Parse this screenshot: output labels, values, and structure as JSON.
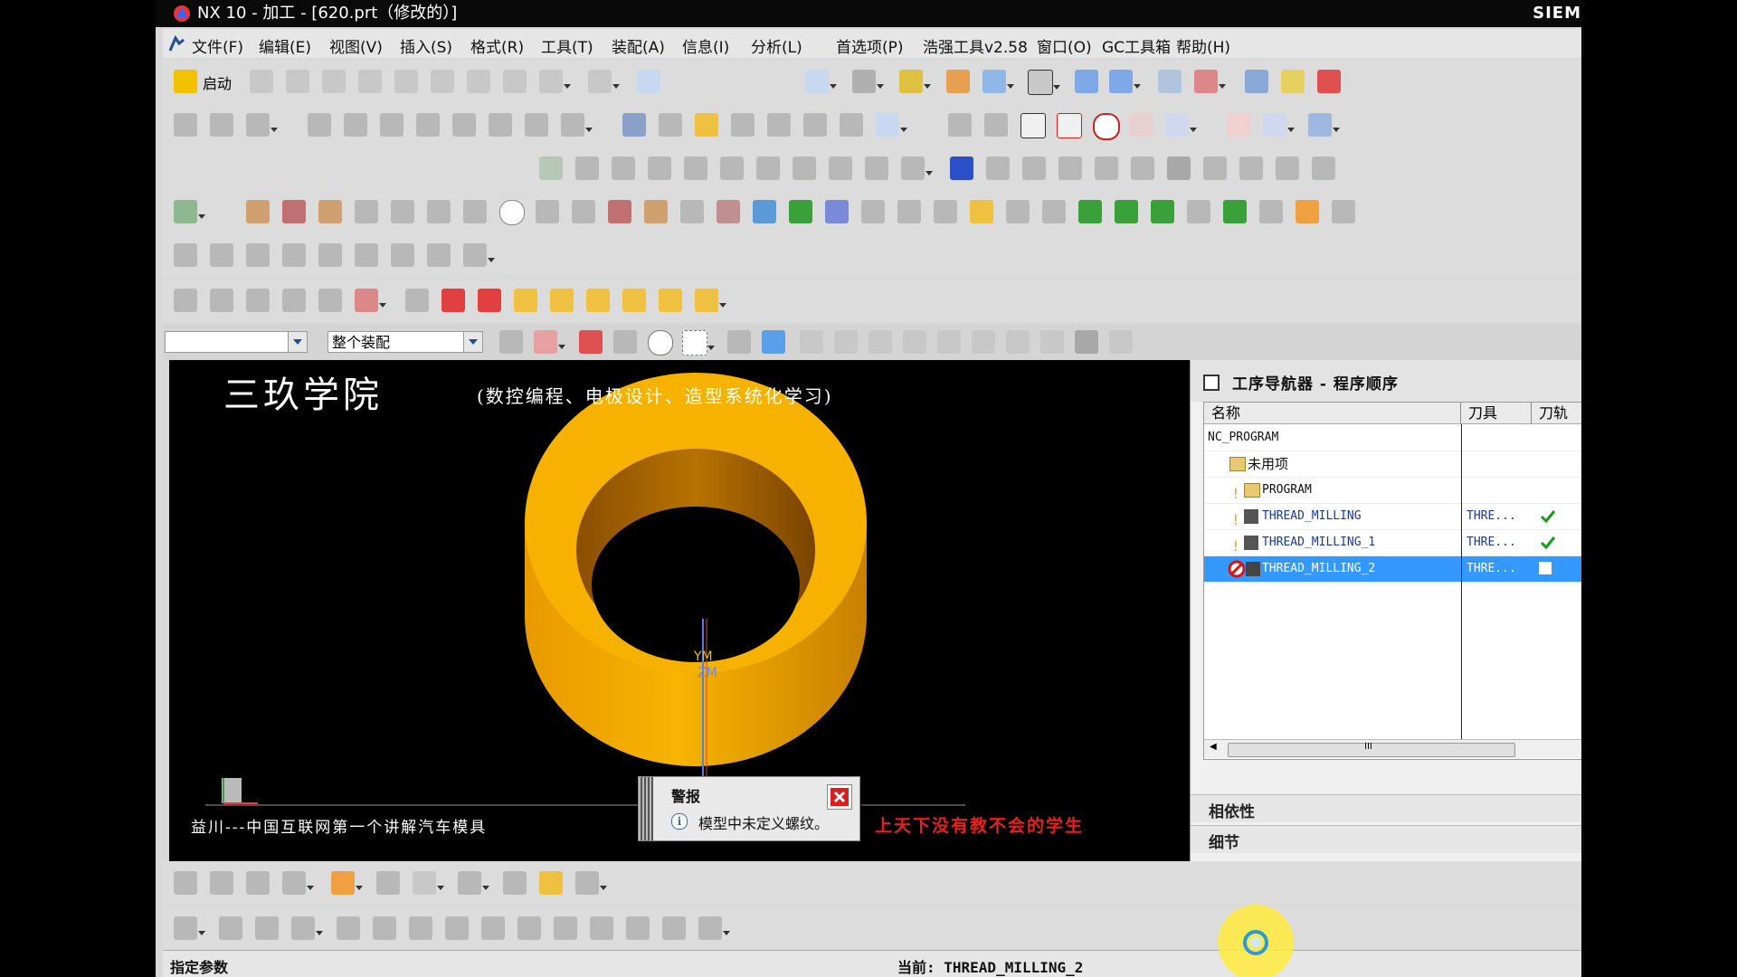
{
  "window": {
    "title": "NX 10 - 加工 - [620.prt（修改的）]",
    "brand": "SIEM"
  },
  "menu": {
    "items": [
      "文件(F)",
      "编辑(E)",
      "视图(V)",
      "插入(S)",
      "格式(R)",
      "工具(T)",
      "装配(A)",
      "信息(I)",
      "分析(L)",
      "首选项(P)",
      "浩强工具v2.58",
      "窗口(O)",
      "GC工具箱",
      "帮助(H)"
    ]
  },
  "toolbar": {
    "start_label": "启动"
  },
  "selection_bar": {
    "filter_value": "",
    "scope_value": "整个装配"
  },
  "viewport": {
    "watermark_title": "三玖学院",
    "watermark_subtitle": "(数控编程、电极设计、造型系统化学习)",
    "watermark_bottom_left": "益川---中国互联网第一个讲解汽车模具",
    "watermark_bottom_right": "上天下没有教不会的学生",
    "axis_labels": {
      "ym": "YM",
      "zm": "ZM"
    },
    "part_color": "#f0a800"
  },
  "alert": {
    "title": "警报",
    "message": "模型中未定义螺纹。"
  },
  "navigator": {
    "title": "工序导航器 - 程序顺序",
    "columns": {
      "name": "名称",
      "tool": "刀具",
      "path": "刀轨"
    },
    "rows": [
      {
        "name": "NC_PROGRAM",
        "tool": "",
        "status": "none"
      },
      {
        "name": "未用项",
        "tool": "",
        "status": "none"
      },
      {
        "name": "PROGRAM",
        "tool": "",
        "status": "none"
      },
      {
        "name": "THREAD_MILLING",
        "tool": "THRE...",
        "status": "ok"
      },
      {
        "name": "THREAD_MILLING_1",
        "tool": "THRE...",
        "status": "ok"
      },
      {
        "name": "THREAD_MILLING_2",
        "tool": "THRE...",
        "status": "empty"
      }
    ],
    "scroll_marker": "III",
    "dependency_label": "相依性",
    "details_label": "细节"
  },
  "status_bar": {
    "left": "指定参数",
    "right": "当前: THREAD_MILLING_2"
  },
  "colors": {
    "selection": "#3399ff",
    "check": "#1a9a1a",
    "error": "#e01010",
    "accent": "#1e4d9a"
  }
}
